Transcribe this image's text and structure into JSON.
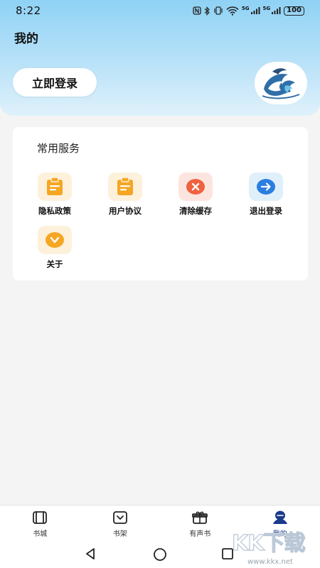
{
  "status_bar": {
    "time": "8:22",
    "network_1": "5G",
    "network_2": "5G",
    "battery": "100"
  },
  "header": {
    "title": "我的",
    "login_label": "立即登录",
    "avatar_icon": "wave-logo-icon"
  },
  "services": {
    "title": "常用服务",
    "items": [
      {
        "label": "隐私政策",
        "icon": "clipboard-icon",
        "color": "#f5a623",
        "bg": "#fdf1dc"
      },
      {
        "label": "用户协议",
        "icon": "clipboard-icon",
        "color": "#f5a623",
        "bg": "#fdf1dc"
      },
      {
        "label": "清除缓存",
        "icon": "close-circle-icon",
        "color": "#f0623f",
        "bg": "#fde5df"
      },
      {
        "label": "退出登录",
        "icon": "arrow-right-circle-icon",
        "color": "#2a7de1",
        "bg": "#dff0fb"
      },
      {
        "label": "关于",
        "icon": "chevron-down-circle-icon",
        "color": "#f5a623",
        "bg": "#fdf1dc"
      }
    ]
  },
  "bottom_nav": {
    "items": [
      {
        "label": "书城",
        "icon": "book-store-icon"
      },
      {
        "label": "书架",
        "icon": "bookshelf-icon"
      },
      {
        "label": "有声书",
        "icon": "gift-box-icon"
      },
      {
        "label": "我的",
        "icon": "profile-icon"
      }
    ],
    "active_index": 3,
    "accent": "#1a3a8a"
  },
  "watermark": {
    "text": "KK下载",
    "url": "www.kkx.net"
  }
}
